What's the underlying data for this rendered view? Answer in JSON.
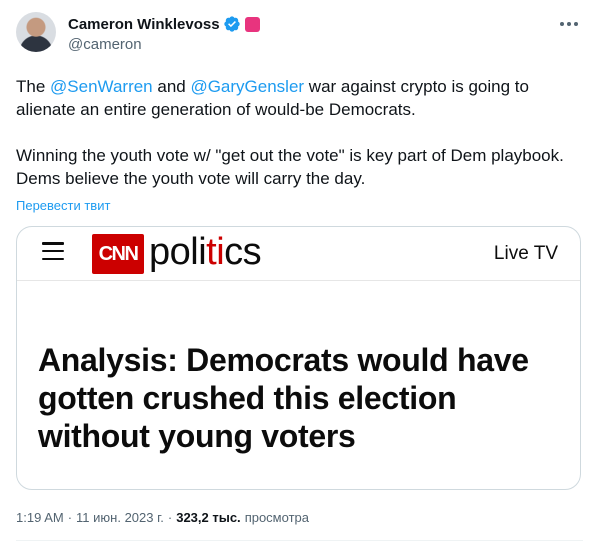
{
  "author": {
    "display_name": "Cameron Winklevoss",
    "handle": "@cameron"
  },
  "tweet": {
    "line1_prefix": "The ",
    "mention1": "@SenWarren",
    "line1_and": " and ",
    "mention2": "@GaryGensler",
    "line1_suffix": " war against crypto is going to alienate an entire generation of would-be Democrats.",
    "paragraph2": "Winning the youth vote w/ \"get out the vote\" is key part of Dem playbook. Dems believe the youth vote will carry the day.",
    "translate_label": "Перевести твит"
  },
  "card": {
    "logo_text": "CNN",
    "section_pre": "poli",
    "section_accent": "ti",
    "section_post": "cs",
    "live_label": "Live TV",
    "headline": "Analysis: Democrats would have gotten crushed this election without young voters"
  },
  "meta": {
    "time": "1:19 AM",
    "separator": "·",
    "date": "11 июн. 2023 г.",
    "views_count": "323,2 тыс.",
    "views_label": "просмотра"
  },
  "colors": {
    "link": "#1d9bf0",
    "cnn_red": "#cc0000",
    "verified": "#1d9bf0",
    "badge_pink": "#e8347e"
  }
}
